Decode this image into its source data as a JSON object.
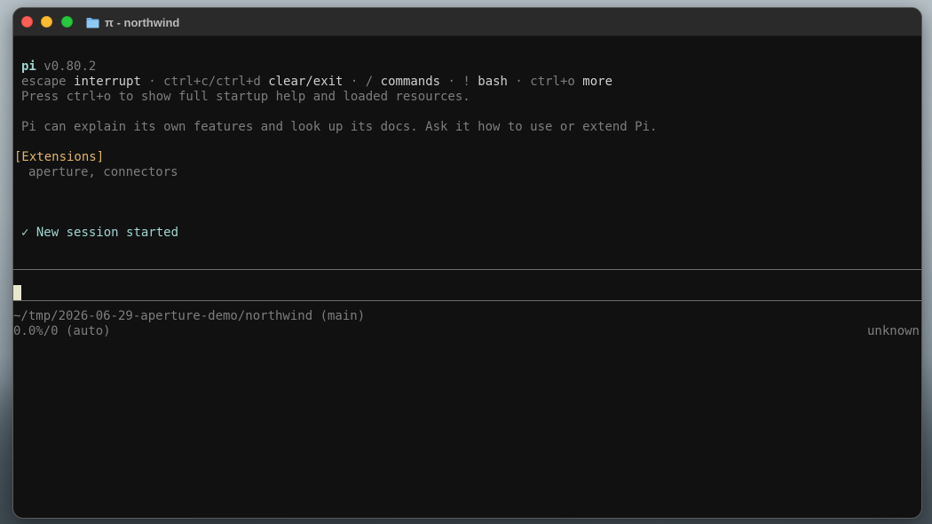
{
  "window": {
    "title": "π - northwind",
    "folder_icon": "folder-icon",
    "colors": {
      "background": "#111111",
      "accent_teal": "#9fd5cf",
      "accent_gold": "#e0b56a",
      "cursor": "#e9e6cf"
    }
  },
  "header": {
    "app_name": "pi",
    "version": "v0.80.2"
  },
  "shortcuts": {
    "escape_key": "escape",
    "escape_action": "interrupt",
    "sep1": " · ",
    "ctrlc_key": "ctrl+c/ctrl+d",
    "ctrlc_action": "clear/exit",
    "sep2": " · ",
    "slash_key": "/",
    "slash_action": "commands",
    "sep3": " · ",
    "bang_key": "!",
    "bang_action": "bash",
    "sep4": " · ",
    "ctrlo_key": "ctrl+o",
    "ctrlo_action": "more"
  },
  "startup_hint": "Press ctrl+o to show full startup help and loaded resources.",
  "info_line": "Pi can explain its own features and look up its docs. Ask it how to use or extend Pi.",
  "extensions": {
    "header": "[Extensions]",
    "list": "aperture, connectors"
  },
  "session": {
    "check_icon": "✓",
    "message": "New session started"
  },
  "status": {
    "path": "~/tmp/2026-06-29-aperture-demo/northwind (main)",
    "usage": "0.0%/0 (auto)",
    "model": "unknown"
  }
}
